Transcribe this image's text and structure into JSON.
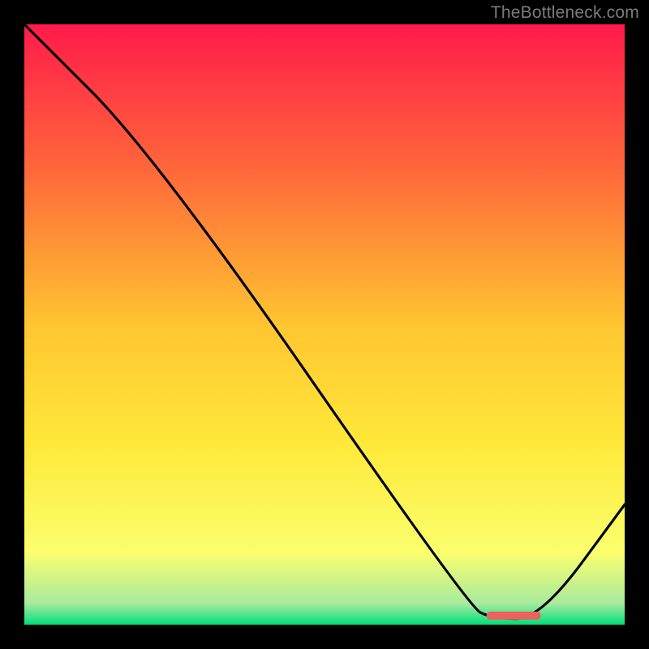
{
  "attribution": "TheBottleneck.com",
  "chart_data": {
    "type": "line",
    "title": "",
    "xlabel": "",
    "ylabel": "",
    "xlim": [
      0,
      100
    ],
    "ylim": [
      0,
      100
    ],
    "x": [
      0,
      22,
      74,
      78,
      86,
      100
    ],
    "values": [
      100,
      78,
      3,
      1,
      1,
      20
    ],
    "gradient_stops": [
      {
        "offset": 0.0,
        "color": "#ff1a4b"
      },
      {
        "offset": 0.25,
        "color": "#ff6a3a"
      },
      {
        "offset": 0.5,
        "color": "#ffc531"
      },
      {
        "offset": 0.7,
        "color": "#ffe93a"
      },
      {
        "offset": 0.88,
        "color": "#fbff6e"
      },
      {
        "offset": 0.965,
        "color": "#a7ea9e"
      },
      {
        "offset": 1.0,
        "color": "#00e07a"
      }
    ],
    "marker": {
      "x_start": 77,
      "x_end": 86,
      "y": 1.5,
      "color": "#e9635f"
    }
  }
}
